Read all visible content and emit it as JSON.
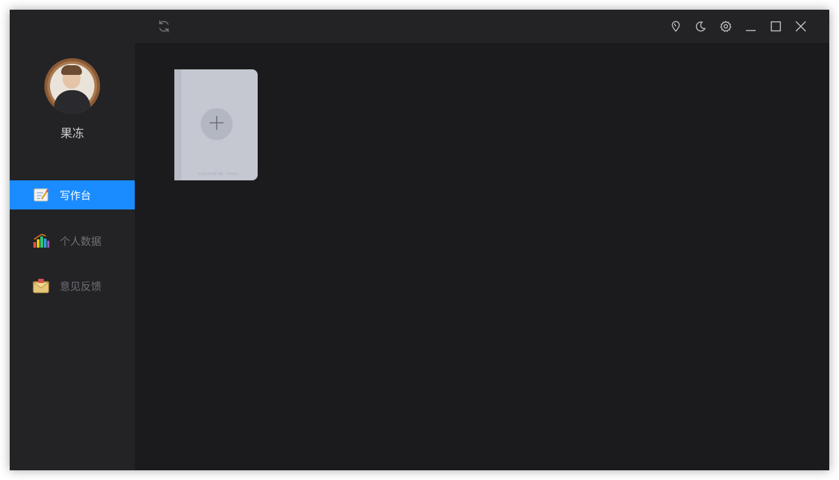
{
  "user": {
    "name": "果冻"
  },
  "sidebar": {
    "items": [
      {
        "label": "写作台",
        "icon": "notepad-pen-icon",
        "active": true
      },
      {
        "label": "个人数据",
        "icon": "bar-chart-icon",
        "active": false
      },
      {
        "label": "意见反馈",
        "icon": "envelope-icon",
        "active": false
      }
    ]
  },
  "topbar": {
    "icons": [
      "refresh-icon",
      "location-pin-icon",
      "moon-icon",
      "gear-icon",
      "minimize-icon",
      "maximize-icon",
      "close-icon"
    ]
  },
  "book": {
    "caption": "点击此处新建书籍，开始创作"
  },
  "colors": {
    "accent": "#1a8cff",
    "sidebar": "#232326",
    "content": "#1b1b1e",
    "book": "#c5c8d1"
  }
}
